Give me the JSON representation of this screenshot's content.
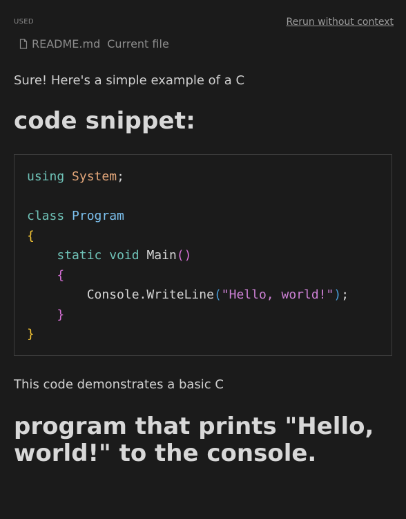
{
  "header": {
    "used_label": "USED",
    "rerun_label": "Rerun without context"
  },
  "file_ref": {
    "icon": "file-icon",
    "filename": "README.md",
    "tag": "Current file"
  },
  "message": {
    "intro": "Sure! Here's a simple example of a C",
    "heading1": "code snippet:",
    "code_lines": [
      "using System;",
      "",
      "class Program",
      "{",
      "    static void Main()",
      "    {",
      "        Console.WriteLine(\"Hello, world!\");",
      "    }",
      "}"
    ],
    "outro": "This code demonstrates a basic C",
    "heading2": "program that prints \"Hello, world!\" to the console."
  },
  "colors": {
    "background": "#1b1b1b",
    "keyword": "#6fc3b8",
    "type": "#e4a77a",
    "class_name": "#7cc1ef",
    "brace": "#f4c535",
    "string": "#ce81d6"
  }
}
